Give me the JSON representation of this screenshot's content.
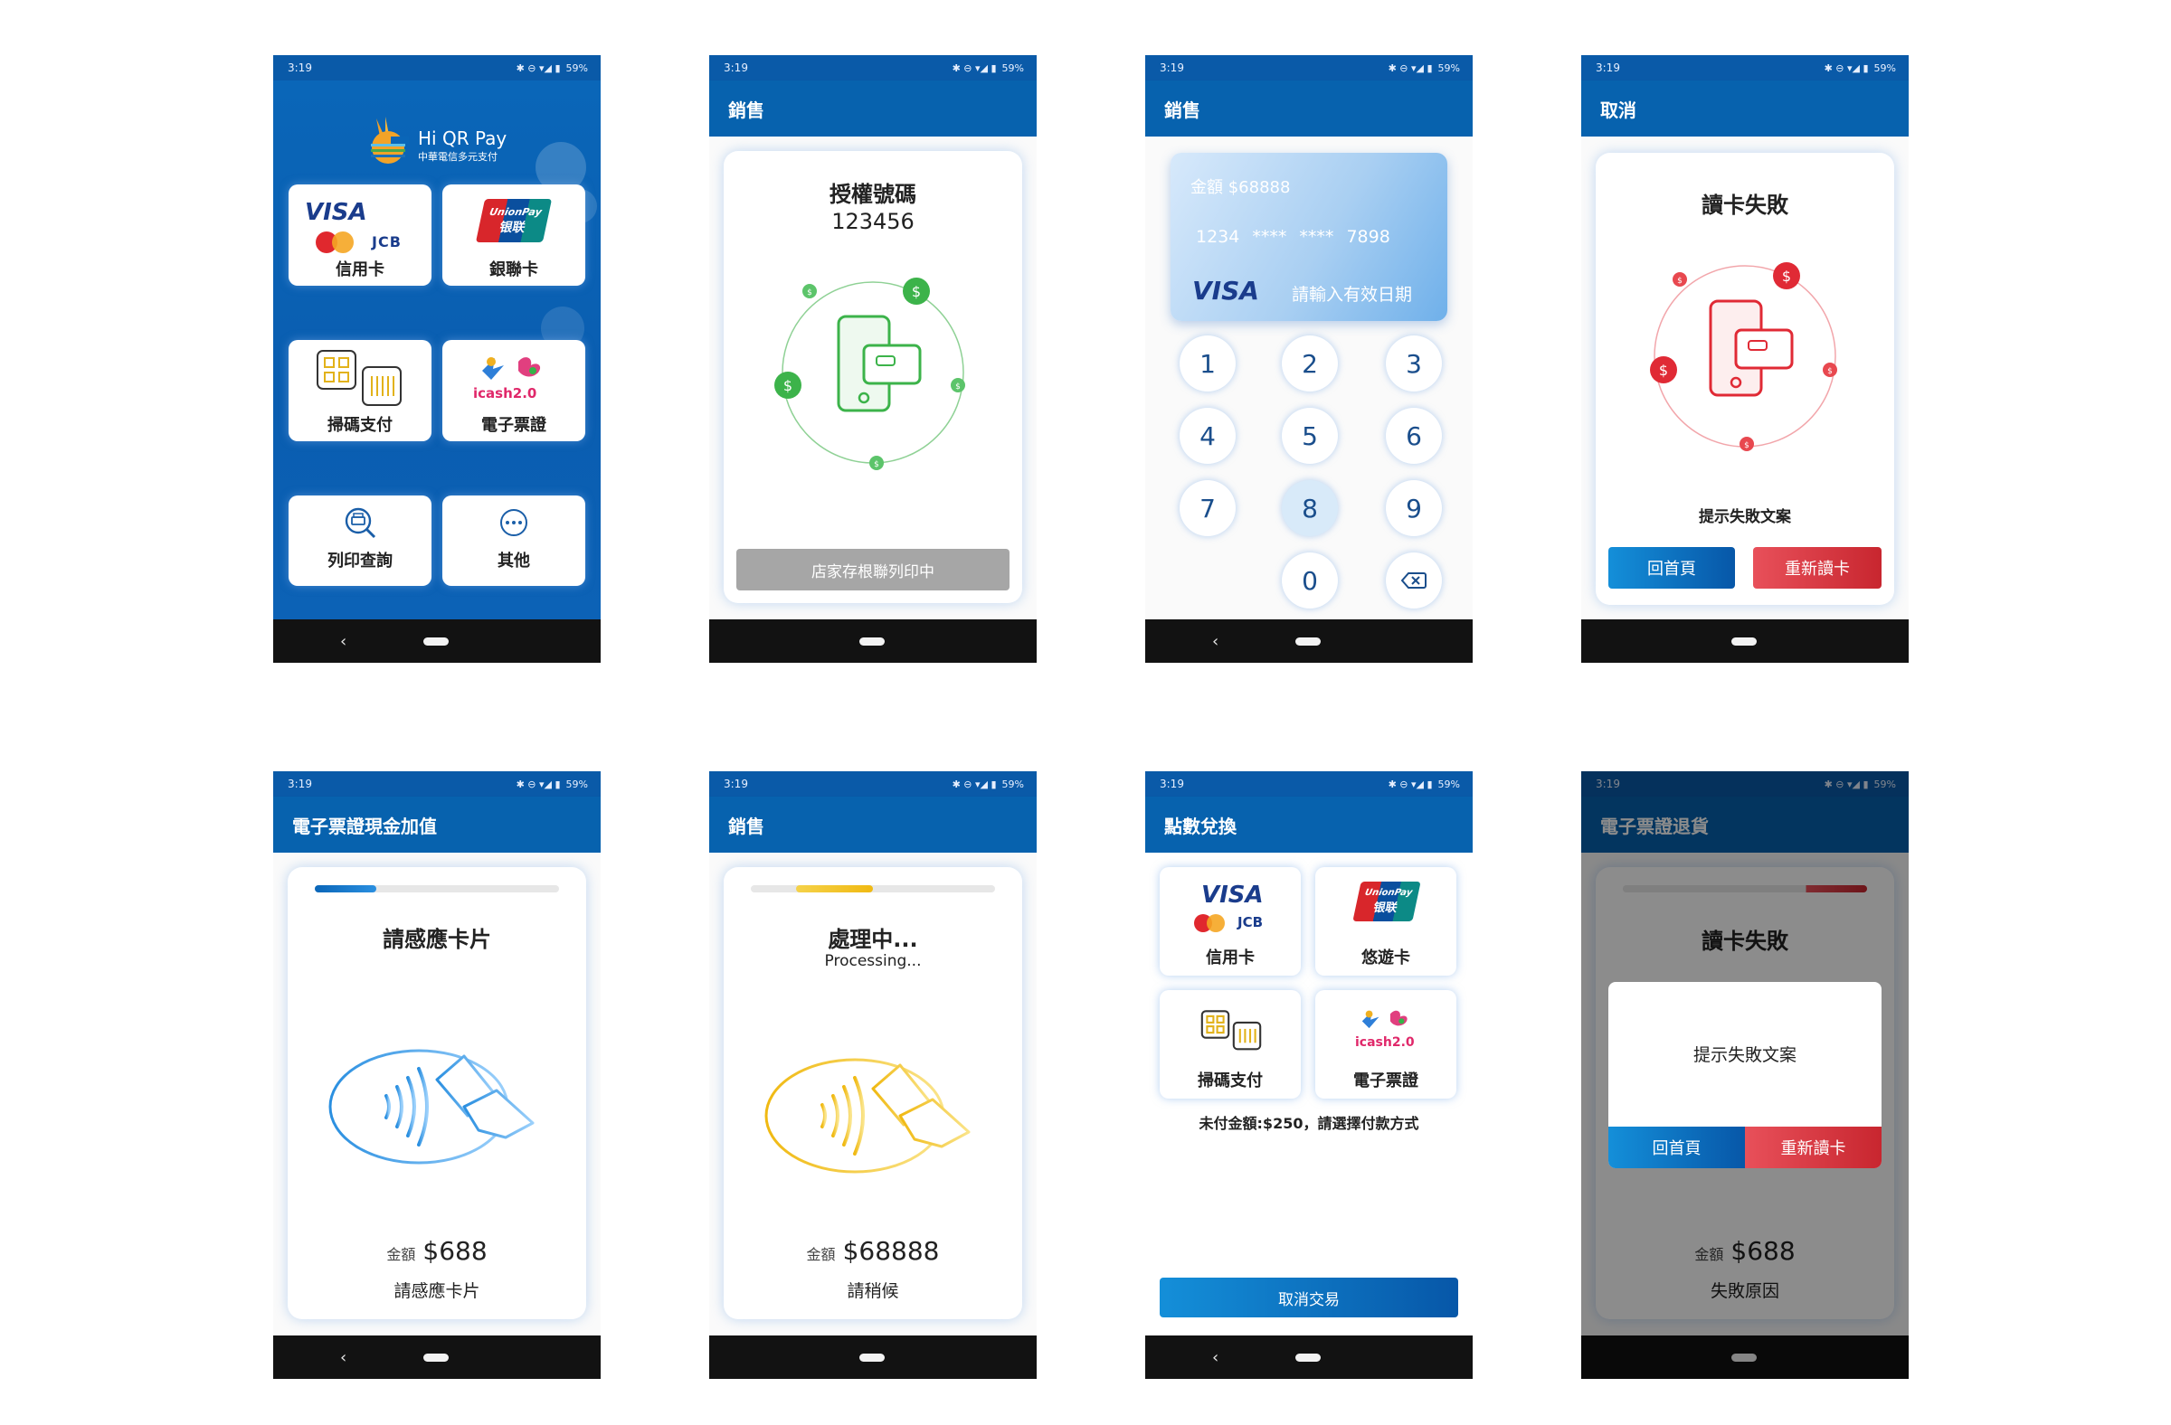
{
  "status": {
    "time": "3:19",
    "battery": "59%",
    "icons": "✱ ⊖ ▾◢ ▮"
  },
  "screens": {
    "home": {
      "brand_name": "Hi QR Pay",
      "brand_sub": "中華電信多元支付",
      "tiles": [
        {
          "label": "信用卡",
          "icon": "credit-card-logos-icon"
        },
        {
          "label": "銀聯卡",
          "icon": "unionpay-logo-icon"
        },
        {
          "label": "掃碼支付",
          "icon": "qr-scan-icon"
        },
        {
          "label": "電子票證",
          "icon": "icash-logo-icon"
        },
        {
          "label": "列印查詢",
          "icon": "print-search-icon"
        },
        {
          "label": "其他",
          "icon": "more-icon"
        }
      ],
      "logos": {
        "visa": "VISA",
        "mastercard": "MasterCard",
        "jcb": "JCB",
        "unionpay_en": "UnionPay",
        "unionpay_zh": "银联",
        "icash": "icash2.0"
      }
    },
    "sale_auth": {
      "appbar": "銷售",
      "auth_title": "授權號碼",
      "auth_code": "123456",
      "button": "店家存根聯列印中"
    },
    "sale_pin": {
      "appbar": "銷售",
      "card_amount": "金額 $68888",
      "card_number": "1234 **** **** 7898",
      "card_brand": "VISA",
      "card_prompt": "請輸入有效日期",
      "keys": [
        "1",
        "2",
        "3",
        "4",
        "5",
        "6",
        "7",
        "8",
        "9",
        "0"
      ],
      "active_key": "8"
    },
    "cancel_fail": {
      "appbar": "取消",
      "title": "讀卡失敗",
      "message": "提示失敗文案",
      "btn_home": "回首頁",
      "btn_retry": "重新讀卡"
    },
    "topup": {
      "appbar": "電子票證現金加值",
      "progress": 0.25,
      "title": "請感應卡片",
      "amount_label": "金額",
      "amount": "$688",
      "hint": "請感應卡片"
    },
    "processing": {
      "appbar": "銷售",
      "progress": 0.5,
      "title": "處理中...",
      "subtitle": "Processing...",
      "amount_label": "金額",
      "amount": "$68888",
      "hint": "請稍候"
    },
    "points": {
      "appbar": "點數兌換",
      "tiles": [
        "信用卡",
        "悠遊卡",
        "掃碼支付",
        "電子票證"
      ],
      "unpaid": "未付金額:$250，請選擇付款方式",
      "cancel": "取消交易"
    },
    "refund": {
      "appbar": "電子票證退貨",
      "progress": 1.0,
      "title": "讀卡失敗",
      "dialog_message": "提示失敗文案",
      "btn_home": "回首頁",
      "btn_retry": "重新讀卡",
      "amount_label": "金額",
      "amount": "$688",
      "reason": "失敗原因"
    }
  },
  "colors": {
    "brand_blue": "#0762ae",
    "green": "#3cb34a",
    "red": "#e02a35",
    "yellow": "#f2c41a",
    "light_blue": "#4aa3e8"
  }
}
